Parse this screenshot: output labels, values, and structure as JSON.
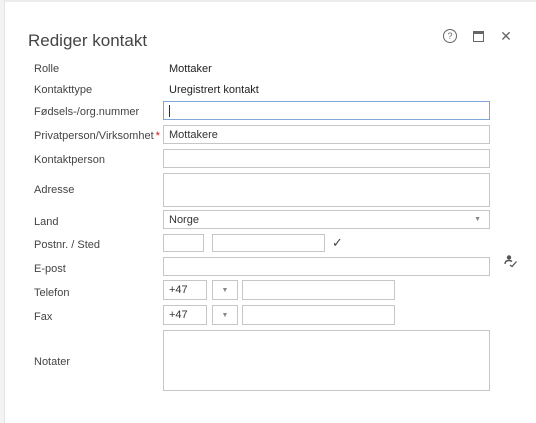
{
  "dialog": {
    "title": "Rediger kontakt"
  },
  "fields": {
    "rolle": {
      "label": "Rolle",
      "value": "Mottaker"
    },
    "kontakttype": {
      "label": "Kontakttype",
      "value": "Uregistrert kontakt"
    },
    "fodselsnummer": {
      "label": "Fødsels-/org.nummer",
      "value": ""
    },
    "privatperson": {
      "label": "Privatperson/Virksomhet",
      "required_mark": "*",
      "value": "Mottakere"
    },
    "kontaktperson": {
      "label": "Kontaktperson",
      "value": ""
    },
    "adresse": {
      "label": "Adresse",
      "value": ""
    },
    "land": {
      "label": "Land",
      "value": "Norge"
    },
    "postnr": {
      "label": "Postnr. / Sted",
      "postnr_value": "",
      "sted_value": ""
    },
    "epost": {
      "label": "E-post",
      "value": ""
    },
    "telefon": {
      "label": "Telefon",
      "prefix": "+47",
      "value": ""
    },
    "fax": {
      "label": "Fax",
      "prefix": "+47",
      "value": ""
    },
    "notater": {
      "label": "Notater",
      "value": ""
    }
  },
  "icons": {
    "help": "?",
    "close": "✕",
    "check": "✓",
    "dropdown": "▼"
  }
}
